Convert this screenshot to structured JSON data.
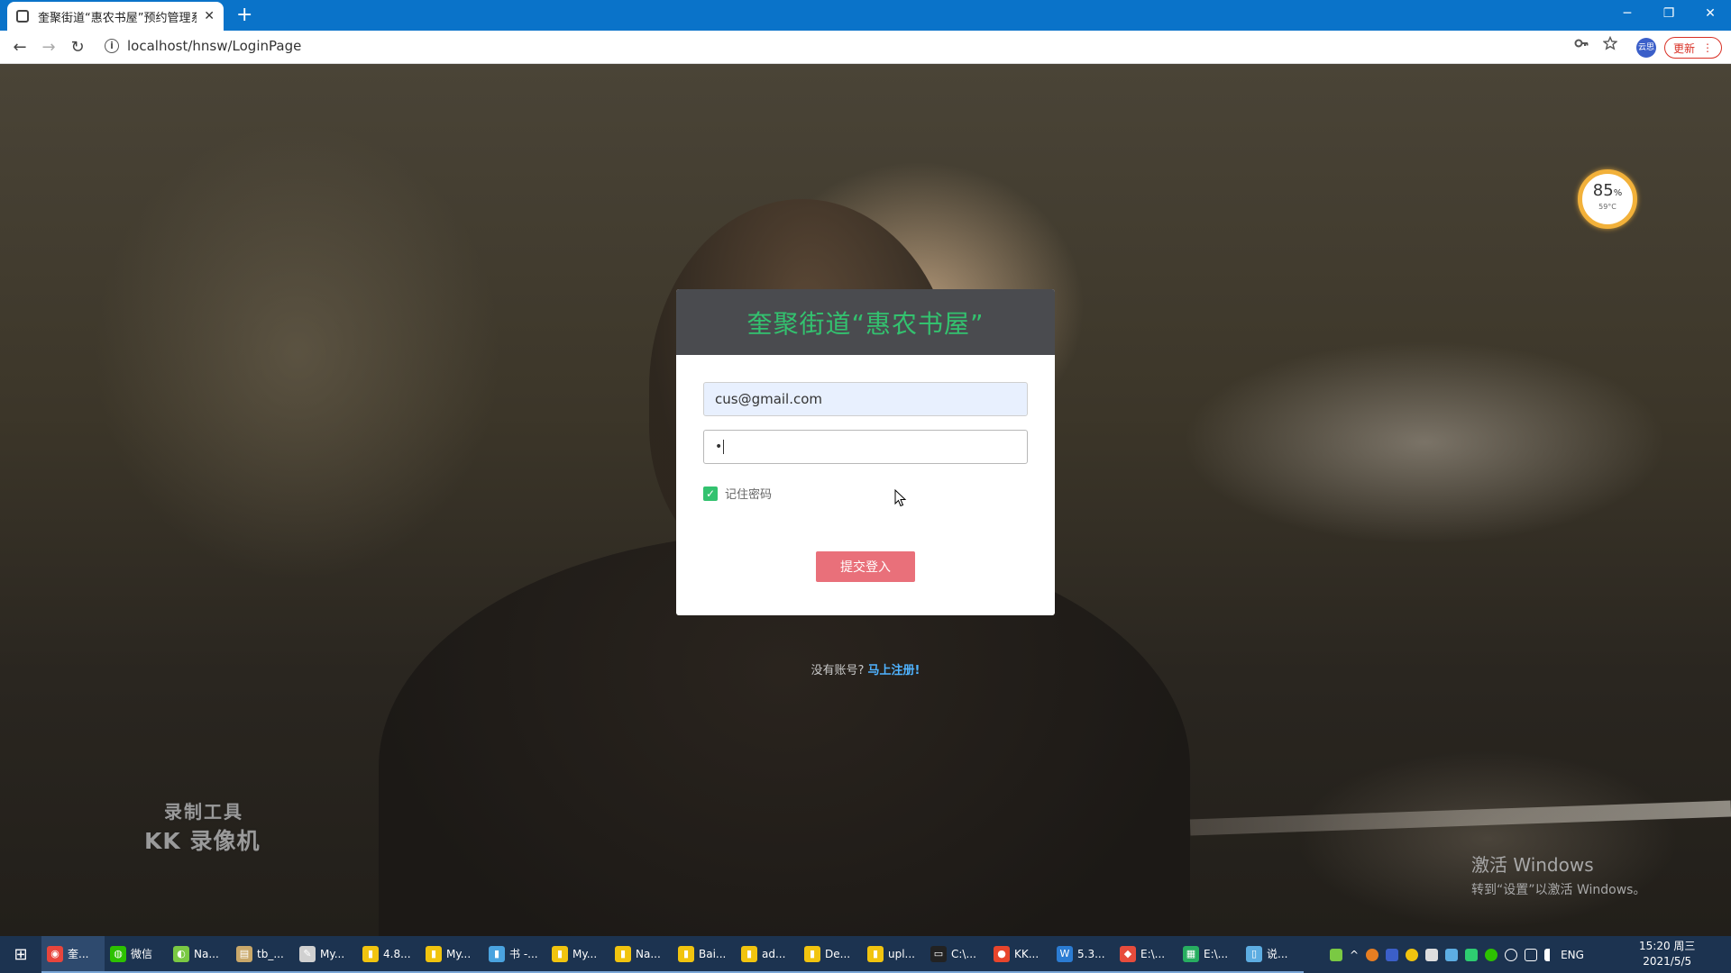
{
  "browser": {
    "tab_title": "奎聚街道“惠农书屋”预约管理系统",
    "tab_close": "✕",
    "new_tab": "+",
    "url": "localhost/hnsw/LoginPage",
    "info_glyph": "i",
    "avatar_text": "云思",
    "update_label": "更新",
    "update_menu": "⋮",
    "window_controls": {
      "minimize": "─",
      "restore": "❐",
      "close": "✕"
    },
    "nav": {
      "back": "←",
      "forward": "→",
      "reload": "↻"
    },
    "icons": {
      "key": "key-icon",
      "star": "star-icon"
    }
  },
  "battery_widget": {
    "percent": "85",
    "percent_sign": "%",
    "temperature": "59°C"
  },
  "login": {
    "title": "奎聚街道“惠农书屋”",
    "email_value": "cus@gmail.com",
    "password_mask": "•",
    "remember_label": "记住密码",
    "remember_checked": true,
    "submit_label": "提交登入",
    "no_account_text": "没有账号?",
    "register_link": "马上注册!"
  },
  "watermarks": {
    "kk_line1": "录制工具",
    "kk_line2": "KK 录像机",
    "activate_line1": "激活 Windows",
    "activate_line2": "转到“设置”以激活 Windows。"
  },
  "taskbar": {
    "start_glyph": "⊞",
    "items": [
      {
        "label": "奎...",
        "color": "#e8453c",
        "glyph": "◉"
      },
      {
        "label": "微信",
        "color": "#2dc100",
        "glyph": "◍"
      },
      {
        "label": "Na...",
        "color": "#7ac943",
        "glyph": "◐"
      },
      {
        "label": "tb_...",
        "color": "#c9a86a",
        "glyph": "▤"
      },
      {
        "label": "My...",
        "color": "#d0d0d0",
        "glyph": "✎"
      },
      {
        "label": "4.8...",
        "color": "#f1c40f",
        "glyph": "▮"
      },
      {
        "label": "My...",
        "color": "#f1c40f",
        "glyph": "▮"
      },
      {
        "label": "书 -...",
        "color": "#4aa3df",
        "glyph": "▮"
      },
      {
        "label": "My...",
        "color": "#f1c40f",
        "glyph": "▮"
      },
      {
        "label": "Na...",
        "color": "#f1c40f",
        "glyph": "▮"
      },
      {
        "label": "Bai...",
        "color": "#f1c40f",
        "glyph": "▮"
      },
      {
        "label": "ad...",
        "color": "#f1c40f",
        "glyph": "▮"
      },
      {
        "label": "De...",
        "color": "#f1c40f",
        "glyph": "▮"
      },
      {
        "label": "upl...",
        "color": "#f1c40f",
        "glyph": "▮"
      },
      {
        "label": "C:\\...",
        "color": "#222222",
        "glyph": "▭"
      },
      {
        "label": "KK...",
        "color": "#e8452c",
        "glyph": "●"
      },
      {
        "label": "5.3...",
        "color": "#2b7cd3",
        "glyph": "W"
      },
      {
        "label": "E:\\...",
        "color": "#e74c3c",
        "glyph": "◆"
      },
      {
        "label": "E:\\...",
        "color": "#27ae60",
        "glyph": "▦"
      },
      {
        "label": "说...",
        "color": "#5dade2",
        "glyph": "▯"
      }
    ],
    "tray_lang": "ENG",
    "time": "15:20 周三",
    "date": "2021/5/5"
  },
  "colors": {
    "accent_green": "#33c26f",
    "submit": "#e9707a",
    "link": "#4fb3ff",
    "chrome_blue": "#0a73c9",
    "taskbar": "#1c3350"
  }
}
